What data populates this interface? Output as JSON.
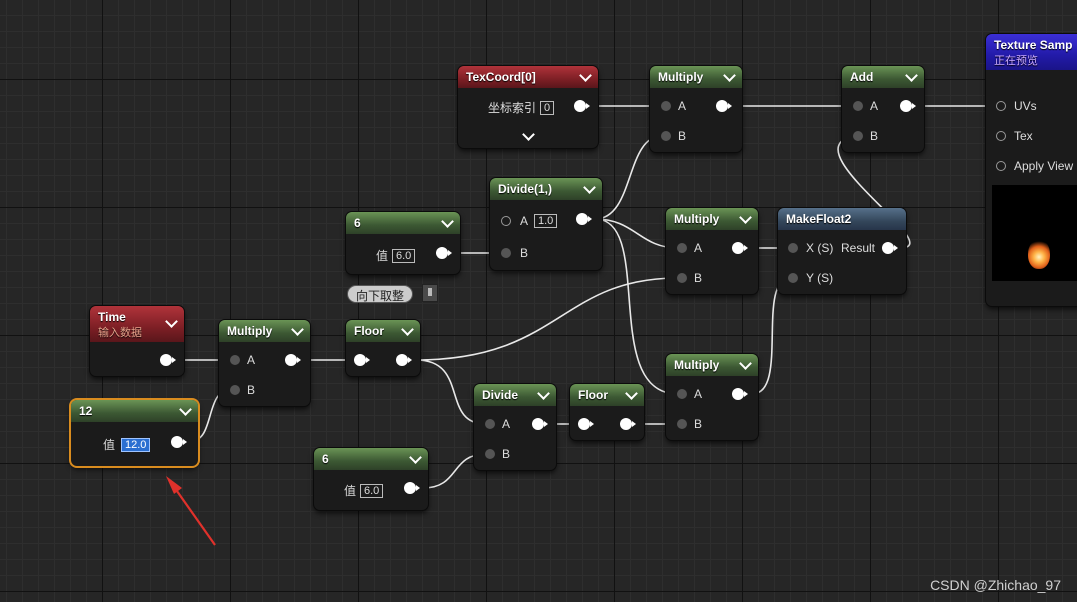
{
  "nodes": {
    "texcoord": {
      "title": "TexCoord[0]",
      "row_label": "坐标索引",
      "value": "0"
    },
    "multiply_top": {
      "title": "Multiply",
      "pin_a": "A",
      "pin_b": "B"
    },
    "add": {
      "title": "Add",
      "pin_a": "A",
      "pin_b": "B"
    },
    "texture_sample": {
      "title": "Texture Samp",
      "subtitle": "正在预览",
      "pins": [
        "UVs",
        "Tex",
        "Apply View"
      ]
    },
    "divide_1": {
      "title": "Divide(1,)",
      "pin_a": "A",
      "pin_a_value": "1.0",
      "pin_b": "B"
    },
    "const_6_top": {
      "title": "6",
      "row_label": "值",
      "value": "6.0"
    },
    "multiply_mid": {
      "title": "Multiply",
      "pin_a": "A",
      "pin_b": "B"
    },
    "makefloat2": {
      "title": "MakeFloat2",
      "pin_x": "X (S)",
      "pin_y": "Y (S)",
      "result": "Result"
    },
    "time": {
      "title": "Time",
      "subtitle": "输入数据"
    },
    "multiply_left": {
      "title": "Multiply",
      "pin_a": "A",
      "pin_b": "B"
    },
    "floor_1": {
      "title": "Floor",
      "tooltip": "向下取整"
    },
    "const_12": {
      "title": "12",
      "row_label": "值",
      "value": "12.0"
    },
    "divide_2": {
      "title": "Divide",
      "pin_a": "A",
      "pin_b": "B"
    },
    "floor_2": {
      "title": "Floor"
    },
    "multiply_bottom": {
      "title": "Multiply",
      "pin_a": "A",
      "pin_b": "B"
    },
    "const_6_bottom": {
      "title": "6",
      "row_label": "值",
      "value": "6.0"
    }
  },
  "watermark": "CSDN @Zhichao_97",
  "colors": {
    "math_header": "#4a6b3f",
    "input_header": "#7d1f25",
    "struct_header": "#34475b",
    "texture_header": "#221aa8",
    "selection": "#d98c1f",
    "annotation_arrow": "#e0312b"
  }
}
